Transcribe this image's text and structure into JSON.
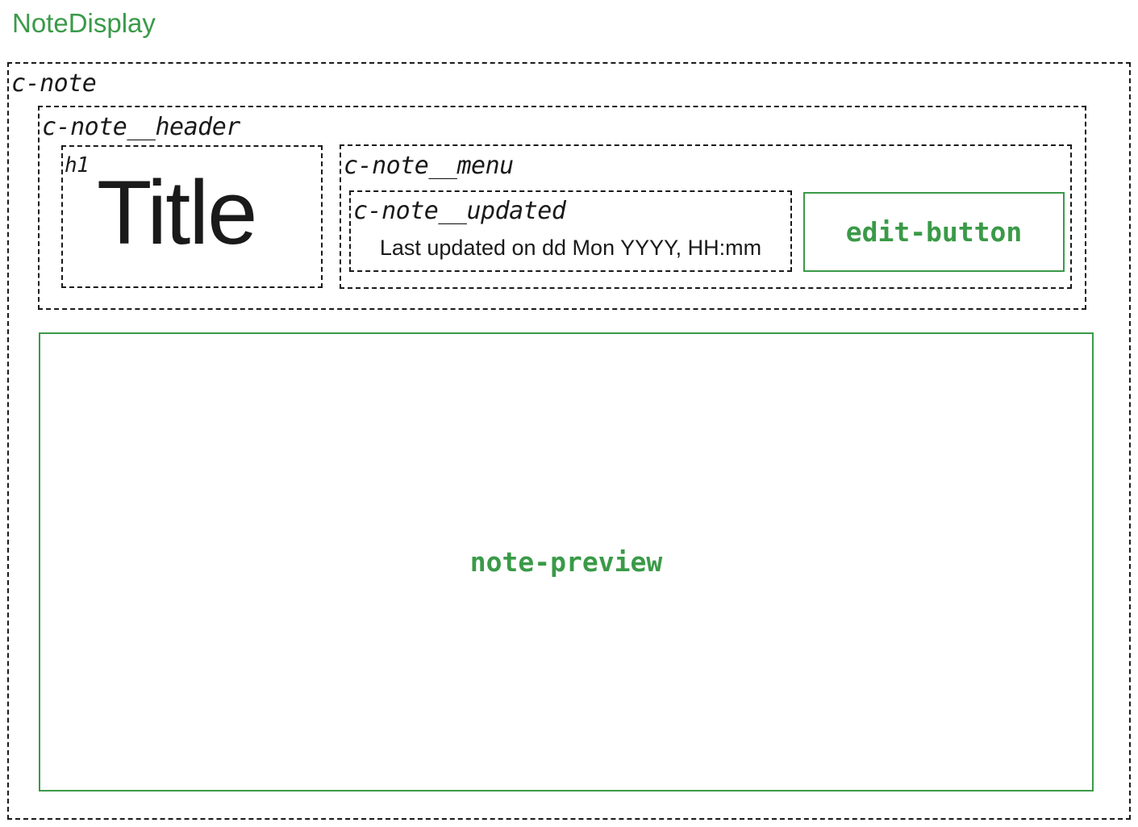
{
  "diagram": {
    "title": "NoteDisplay",
    "c_note": {
      "label": "c-note"
    },
    "header": {
      "label": "c-note__header"
    },
    "h1": {
      "label": "h1",
      "text": "Title"
    },
    "menu": {
      "label": "c-note__menu"
    },
    "updated": {
      "label": "c-note__updated",
      "text": "Last updated on dd Mon YYYY, HH:mm"
    },
    "edit_button": {
      "label": "edit-button"
    },
    "note_preview": {
      "label": "note-preview"
    }
  },
  "colors": {
    "accent_green": "#3a9a48",
    "border_dark": "#1a1a1a",
    "background": "#ffffff"
  }
}
